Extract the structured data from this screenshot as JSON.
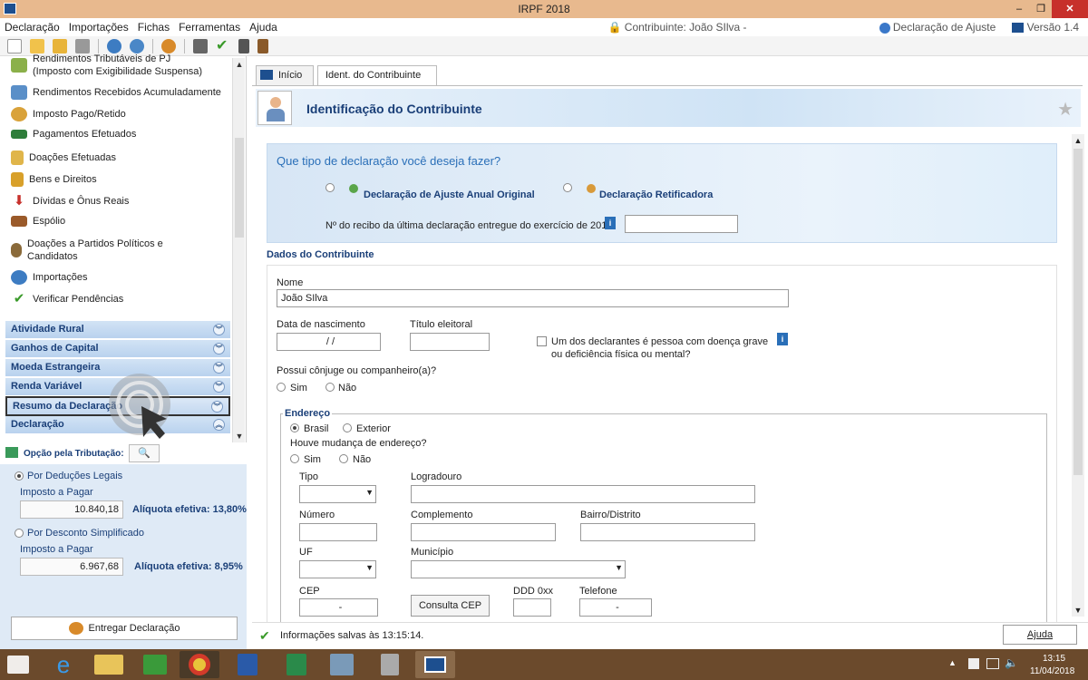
{
  "window": {
    "title": "IRPF 2018"
  },
  "menu": {
    "items": [
      "Declaração",
      "Importações",
      "Fichas",
      "Ferramentas",
      "Ajuda"
    ],
    "contribuinte": "Contribuinte: João SIlva -",
    "declaracao": "Declaração de Ajuste",
    "versao": "Versão 1.4"
  },
  "sidebar": {
    "items": [
      "Rendimentos Tributáveis de PJ (Imposto com Exigibilidade Suspensa)",
      "Rendimentos Recebidos Acumuladamente",
      "Imposto Pago/Retido",
      "Pagamentos Efetuados",
      "Doações Efetuadas",
      "Bens e Direitos",
      "Dívidas e Ônus Reais",
      "Espólio",
      "Doações a Partidos Políticos e Candidatos",
      "Importações",
      "Verificar Pendências"
    ],
    "sections": [
      "Atividade Rural",
      "Ganhos de Capital",
      "Moeda Estrangeira",
      "Renda Variável",
      "Resumo da Declaração",
      "Declaração"
    ]
  },
  "tributacao": {
    "label": "Opção pela Tributação:",
    "deducoes_label": "Por Deduções Legais",
    "imposto_label_1": "Imposto a Pagar",
    "imposto_value_1": "10.840,18",
    "aliquota_1": "Alíquota efetiva: 13,80%",
    "simplificado_label": "Por Desconto Simplificado",
    "imposto_label_2": "Imposto a Pagar",
    "imposto_value_2": "6.967,68",
    "aliquota_2": "Alíquota efetiva: 8,95%",
    "entregar": "Entregar Declaração"
  },
  "tabs": [
    "Início",
    "Ident. do Contribuinte"
  ],
  "tab_close": "×",
  "page_title": "Identificação do Contribuinte",
  "question": {
    "text": "Que tipo de declaração você deseja fazer?",
    "opt1": "Declaração de Ajuste Anual Original",
    "opt2": "Declaração Retificadora",
    "recibo_label": "Nº do recibo da última declaração entregue do exercício de 2017"
  },
  "dados": {
    "section": "Dados do Contribuinte",
    "nome_label": "Nome",
    "nome_value": "João SIlva",
    "nasc_label": "Data de nascimento",
    "nasc_value": "/ /",
    "titulo_label": "Título eleitoral",
    "doenca_label_1": "Um dos declarantes é pessoa com doença grave",
    "doenca_label_2": "ou deficiência física ou mental?",
    "conjuge_label": "Possui cônjuge ou companheiro(a)?",
    "sim": "Sim",
    "nao": "Não"
  },
  "endereco": {
    "legend": "Endereço",
    "brasil": "Brasil",
    "exterior": "Exterior",
    "mudanca": "Houve mudança de endereço?",
    "sim": "Sim",
    "nao": "Não",
    "tipo": "Tipo",
    "logradouro": "Logradouro",
    "numero": "Número",
    "complemento": "Complemento",
    "bairro": "Bairro/Distrito",
    "uf": "UF",
    "municipio": "Município",
    "cep": "CEP",
    "cep_value": "-",
    "consulta": "Consulta CEP",
    "ddd": "DDD 0xx",
    "telefone": "Telefone",
    "tel_value": "-"
  },
  "status": {
    "saved": "Informações salvas às 13:15:14.",
    "ajuda": "Ajuda"
  },
  "taskbar": {
    "time": "13:15",
    "date": "11/04/2018"
  }
}
